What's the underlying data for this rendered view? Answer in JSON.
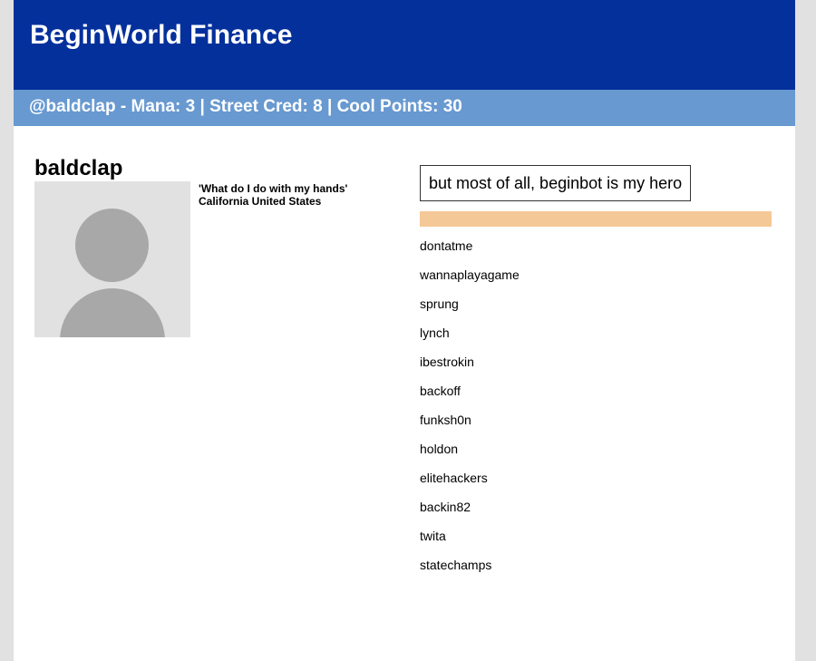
{
  "header": {
    "title": "BeginWorld Finance"
  },
  "stats_bar": {
    "text": "@baldclap - Mana: 3 | Street Cred: 8 | Cool Points: 30"
  },
  "profile": {
    "username": "baldclap",
    "avatar_icon": "default-user-avatar-icon",
    "quote": "'What do I do with my hands'",
    "location": "California United States"
  },
  "motto": "but most of all, beginbot is my hero",
  "commands": [
    "dontatme",
    "wannaplayagame",
    "sprung",
    "lynch",
    "ibestrokin",
    "backoff",
    "funksh0n",
    "holdon",
    "elitehackers",
    "backin82",
    "twita",
    "statechamps"
  ],
  "colors": {
    "header_bg": "#04309c",
    "stats_bg": "#6899d0",
    "accent_bar": "#f5c897",
    "page_bg": "#e1e1e1"
  }
}
